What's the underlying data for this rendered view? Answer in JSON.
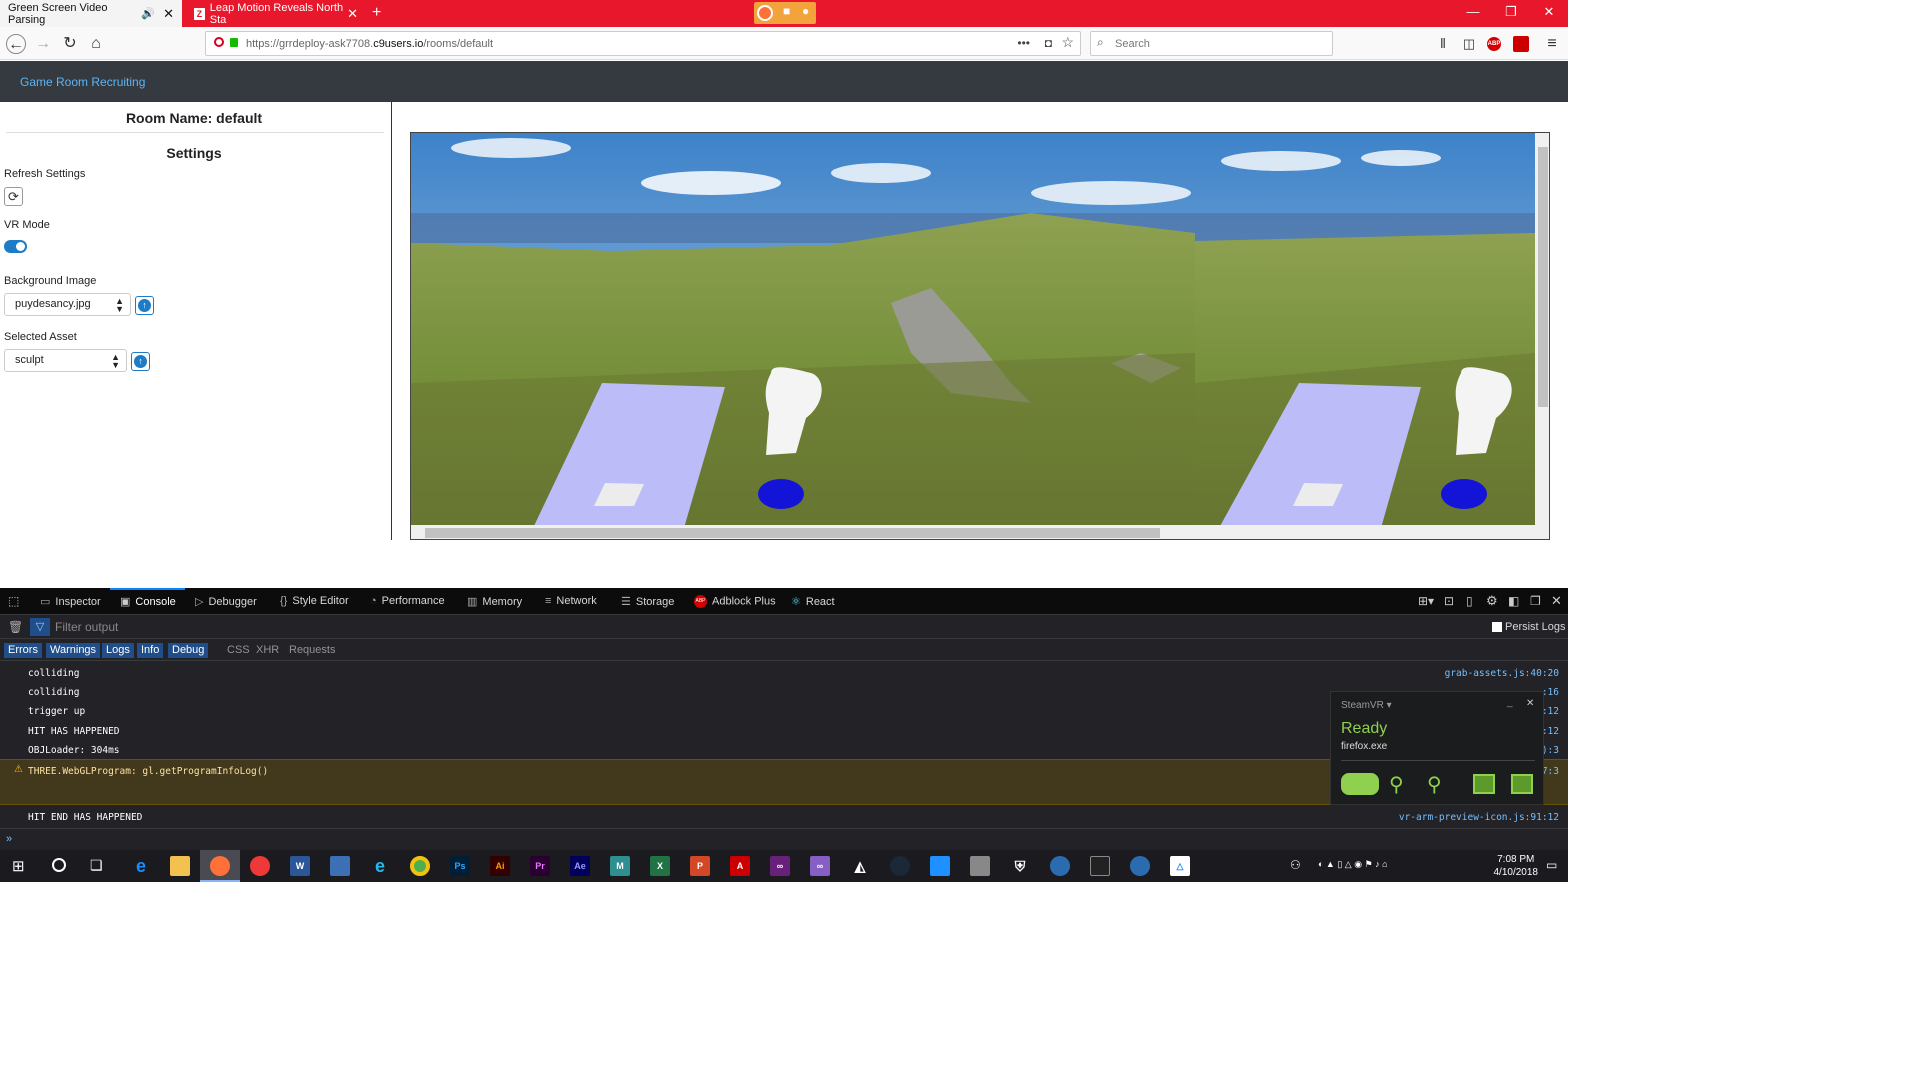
{
  "browser": {
    "tabs": [
      {
        "title": "Green Screen Video Parsing",
        "active": true
      },
      {
        "title": "Leap Motion Reveals North Sta",
        "active": false
      }
    ],
    "url_prefix": "https://grrdeploy-ask7708.",
    "url_host": "c9users.io",
    "url_path": "/rooms/default",
    "search_placeholder": "Search",
    "addon_label": "ABP"
  },
  "app": {
    "brand": "Game Room Recruiting",
    "room_title": "Room Name: default",
    "settings_title": "Settings",
    "refresh_label": "Refresh Settings",
    "vr_label": "VR Mode",
    "vr_mode": true,
    "bg_label": "Background Image",
    "bg_value": "puydesancy.jpg",
    "asset_label": "Selected Asset",
    "asset_value": "sculpt"
  },
  "devtools": {
    "tabs": [
      "Inspector",
      "Console",
      "Debugger",
      "Style Editor",
      "Performance",
      "Memory",
      "Network",
      "Storage",
      "Adblock Plus",
      "React"
    ],
    "active_tab": "Console",
    "filter_placeholder": "Filter output",
    "persist_logs": "Persist Logs",
    "categories_on": [
      "Errors",
      "Warnings",
      "Logs",
      "Info",
      "Debug"
    ],
    "categories_off": [
      "CSS",
      "XHR",
      "Requests"
    ],
    "logs": [
      {
        "msg": "colliding",
        "src": "grab-assets.js:40:20"
      },
      {
        "msg": "colliding",
        "src": ":16"
      },
      {
        "msg": "trigger up",
        "src": ":12"
      },
      {
        "msg": "HIT HAS HAPPENED",
        "src": ":12"
      },
      {
        "msg": "OBJLoader: 304ms",
        "src": "):3"
      }
    ],
    "warning": {
      "msg": "THREE.WebGLProgram: gl.getProgramInfoLog()",
      "src": "7:3"
    },
    "last_log": {
      "msg": "HIT END HAS HAPPENED",
      "src": "vr-arm-preview-icon.js:91:12"
    }
  },
  "steamvr": {
    "title": "SteamVR",
    "status": "Ready",
    "app": "firefox.exe",
    "status_color": "#8fd14f"
  },
  "taskbar": {
    "icons": [
      "Ps",
      "Ai",
      "Pr",
      "Ae",
      "M"
    ],
    "time": "7:08 PM",
    "date": "4/10/2018"
  },
  "colors": {
    "tabbar": "#e8172b",
    "app_header": "#343a40",
    "brand_link": "#5eb4f5",
    "devtools_bg": "#232327"
  }
}
